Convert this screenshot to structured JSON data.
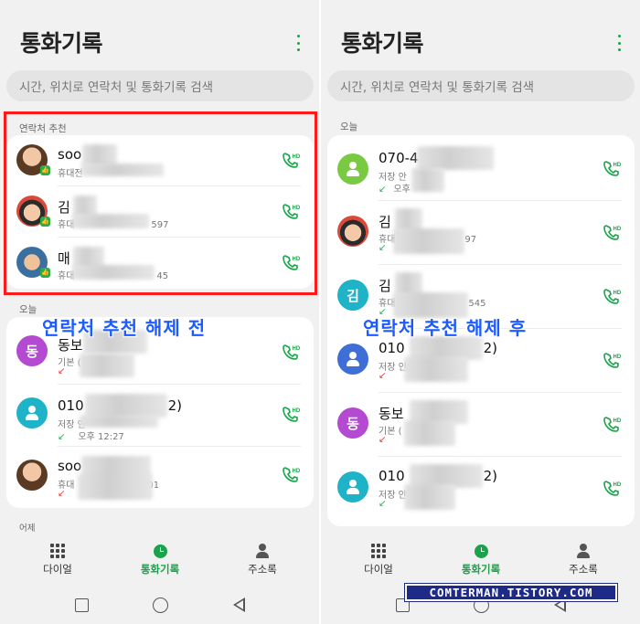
{
  "app": {
    "title": "통화기록",
    "more_icon": "more-vertical-icon",
    "accent": "#1aa34a"
  },
  "search": {
    "placeholder": "시간, 위치로 연락처 및 통화기록 검색"
  },
  "left": {
    "recommend_label": "연락처 추천",
    "recommend": [
      {
        "name": "soo",
        "sub": "휴대전",
        "sub_tail": ""
      },
      {
        "name": "김",
        "sub": "휴대",
        "sub_tail": "597"
      },
      {
        "name": "매",
        "sub": "휴대",
        "sub_tail": "45"
      }
    ],
    "today_label": "오늘",
    "today": [
      {
        "initial": "동",
        "name": "동보",
        "sub": "기본 (",
        "sub2": ""
      },
      {
        "name": "010",
        "name_tail": "2)",
        "sub": "저장 안",
        "sub2": "오후 12:27"
      },
      {
        "name": "soo",
        "sub": "휴대",
        "sub_tail": "01",
        "sub2": ""
      }
    ],
    "yesterday_label": "어제",
    "caption": "연락처 추천 해제 전"
  },
  "right": {
    "today_label": "오늘",
    "today": [
      {
        "name": "070-4",
        "name_tail": ")",
        "sub": "저장 안",
        "sub2": "오후"
      },
      {
        "name": "김",
        "sub": "휴대",
        "sub_tail": "97"
      },
      {
        "initial": "김",
        "name": "김",
        "sub": "휴대",
        "sub_tail": "545"
      },
      {
        "name": "010",
        "name_tail": "2)",
        "sub": "저장 인"
      },
      {
        "initial": "동",
        "name": "동보",
        "sub": "기본 ("
      },
      {
        "name": "010",
        "name_tail": "2)",
        "sub": "저장 안"
      }
    ],
    "caption": "연락처 추천 해제 후"
  },
  "nav": {
    "dial": "다이얼",
    "calllog": "통화기록",
    "contacts": "주소록"
  },
  "hd_label": "HD",
  "watermark": "COMTERMAN.TISTORY.COM"
}
